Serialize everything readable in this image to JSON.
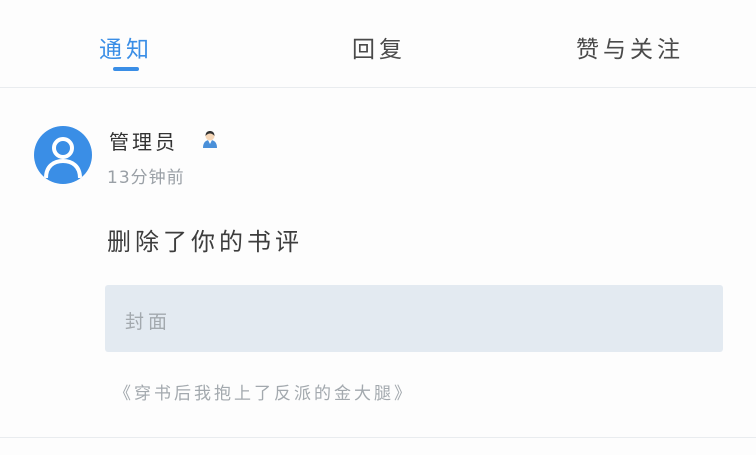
{
  "tabs": [
    {
      "label": "通知",
      "active": true
    },
    {
      "label": "回复",
      "active": false
    },
    {
      "label": "赞与关注",
      "active": false
    }
  ],
  "colors": {
    "accent": "#3a8ee6",
    "avatar_bg": "#3a8ee6",
    "cover_bg": "#e3eaf1"
  },
  "notification": {
    "avatar_icon": "user-avatar-icon",
    "badge_icon": "admin-person-icon",
    "username": "管理员",
    "time": "13分钟前",
    "message": "删除了你的书评",
    "cover_label": "封面",
    "book_title": "《穿书后我抱上了反派的金大腿》"
  }
}
